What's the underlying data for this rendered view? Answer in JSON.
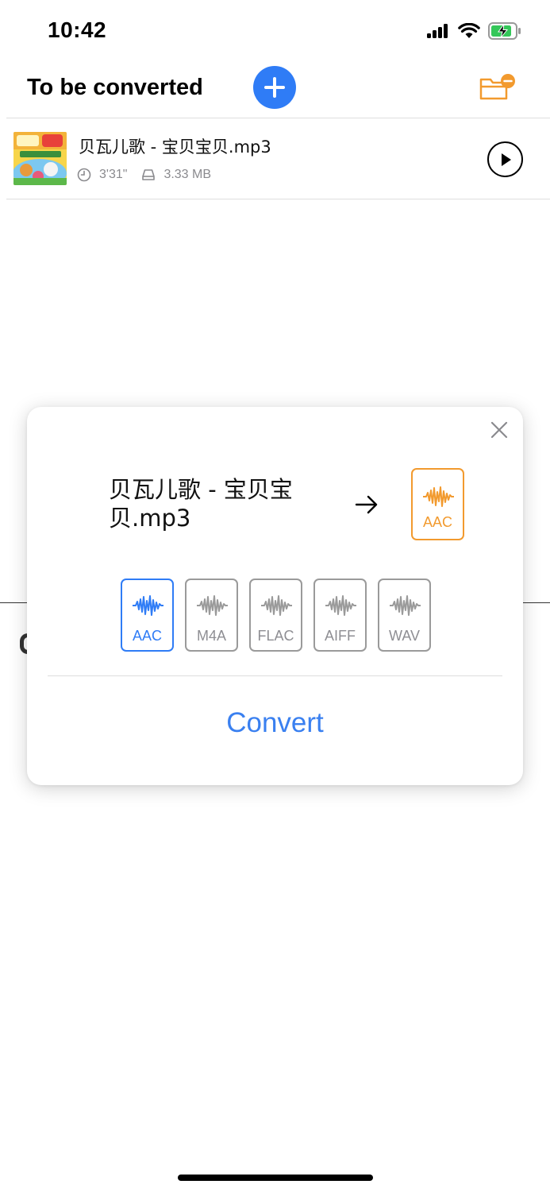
{
  "status_bar": {
    "time": "10:42"
  },
  "header": {
    "title": "To be converted"
  },
  "file_list": [
    {
      "name": "贝瓦儿歌 - 宝贝宝贝.mp3",
      "duration": "3'31\"",
      "size": "3.33 MB"
    }
  ],
  "dialog": {
    "source_name": "贝瓦儿歌 - 宝贝宝贝.mp3",
    "target_format": "AAC",
    "formats": [
      "AAC",
      "M4A",
      "FLAC",
      "AIFF",
      "WAV"
    ],
    "selected_format": "AAC",
    "convert_label": "Convert"
  },
  "colors": {
    "accent_blue": "#2f7cf6",
    "accent_orange": "#f29a2e",
    "inactive_gray": "#9a9a9a"
  },
  "icons": {
    "add": "plus-icon",
    "folder": "folder-remove-icon",
    "play": "play-icon",
    "close": "close-icon",
    "duration": "clock-icon",
    "size": "storage-icon",
    "arrow": "arrow-right-icon",
    "waveform": "waveform-icon"
  }
}
